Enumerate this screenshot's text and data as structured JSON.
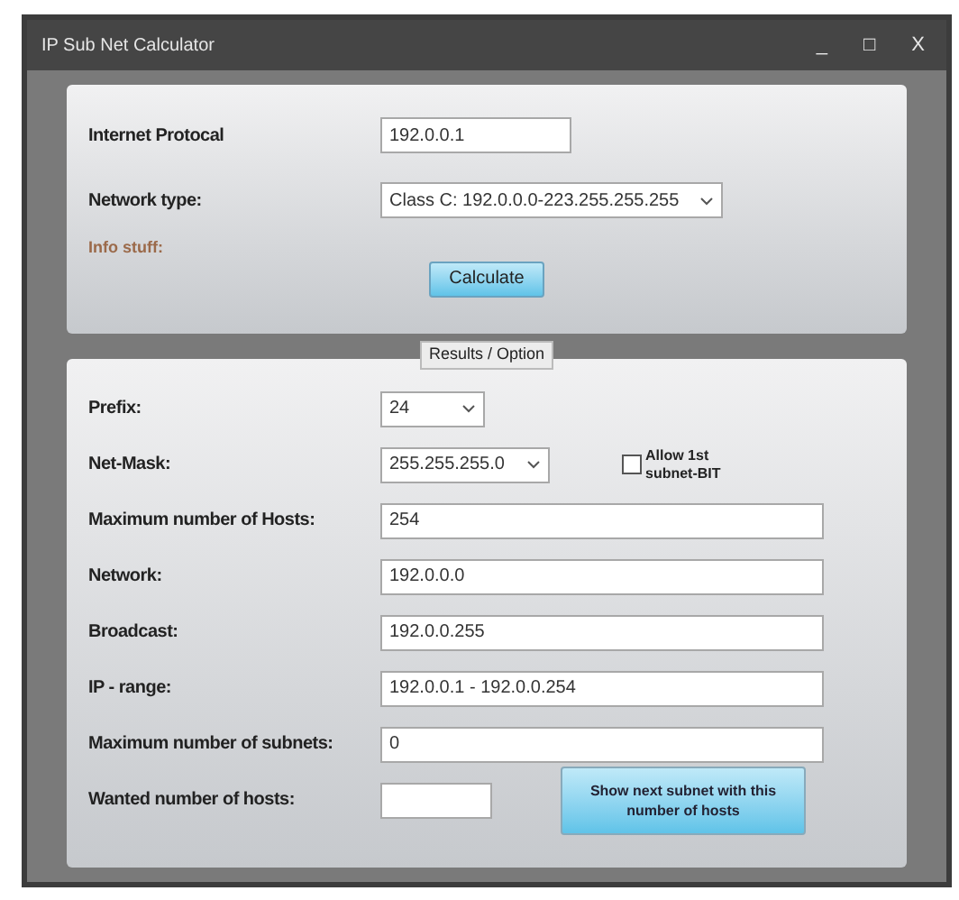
{
  "window": {
    "title": "IP Sub Net Calculator",
    "controls": [
      "_",
      "□",
      "X"
    ]
  },
  "input_rows": [
    {
      "label": "Internet Protocal",
      "kind": "text-medium",
      "value": "192.0.0.1"
    },
    {
      "label": "Network type:",
      "kind": "select",
      "value": "Class C: 192.0.0.0-223.255.255.255"
    }
  ],
  "info_label": "Info stuff:",
  "calculate_button": "Calculate",
  "results_group": {
    "title": "Results / Option",
    "rows": [
      {
        "label": "Prefix:",
        "kind": "select-short",
        "value": "24"
      },
      {
        "label": "Net-Mask:",
        "kind": "select",
        "value": "255.255.255.0",
        "checkbox": {
          "label": "Allow 1st subnet-BIT",
          "checked": false
        }
      },
      {
        "label": "Maximum number of Hosts:",
        "kind": "text",
        "value": "254"
      },
      {
        "label": "Network:",
        "kind": "text",
        "value": "192.0.0.0"
      },
      {
        "label": "Broadcast:",
        "kind": "text",
        "value": "192.0.0.255"
      },
      {
        "label": "IP - range:",
        "kind": "text",
        "value": "192.0.0.1 - 192.0.0.254"
      },
      {
        "label": "Maximum number of subnets:",
        "kind": "text",
        "value": "0"
      },
      {
        "label": "Wanted number of hosts:",
        "kind": "text-short",
        "value": "",
        "button": "Show next subnet with this number of hosts"
      }
    ]
  }
}
